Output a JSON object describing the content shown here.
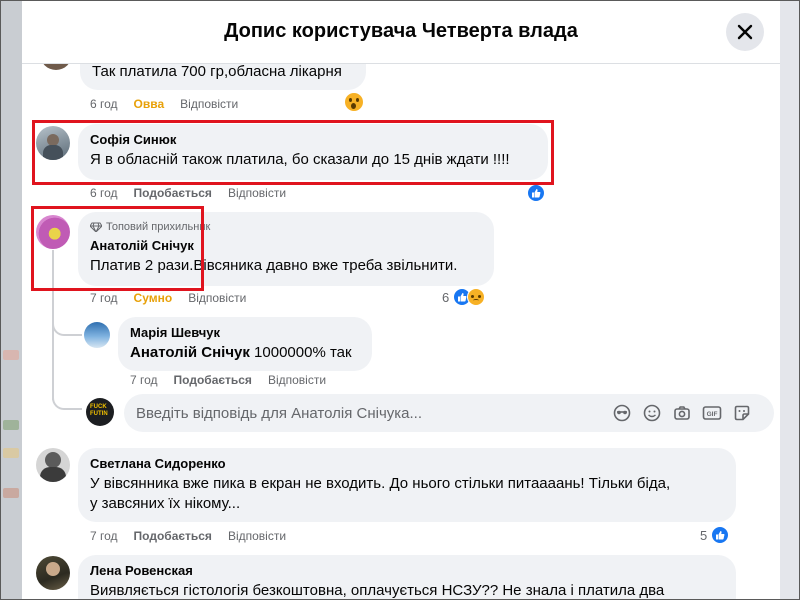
{
  "dialog": {
    "title": "Допис користувача Четверта влада"
  },
  "comments": [
    {
      "id": "top",
      "text": "Так платила 700 гр,обласна лікарня",
      "time": "6 год",
      "reaction_label": "Овва",
      "reply_label": "Відповісти"
    },
    {
      "id": "sofia",
      "author": "Софія Синюк",
      "text": "Я в обласній також платила, бо сказали до 15 днів ждати !!!!",
      "time": "6 год",
      "like_label": "Подобається",
      "reply_label": "Відповісти"
    },
    {
      "id": "anatolii",
      "badge": "Топовий прихильник",
      "author": "Анатолій Снічук",
      "text": "Платив 2 рази.Вівсяника давно вже треба звільнити.",
      "time": "7 год",
      "reaction_label": "Сумно",
      "reply_label": "Відповісти",
      "reaction_count": "6"
    },
    {
      "id": "mariia",
      "author": "Марія Шевчук",
      "mention": "Анатолій Снічук",
      "text": " 1000000% так",
      "time": "7 год",
      "like_label": "Подобається",
      "reply_label": "Відповісти"
    },
    {
      "id": "svetlana",
      "author": "Светлана Сидоренко",
      "text_lines": [
        "У вівсянника вже пика в екран не входить. До нього стільки питаааань! Тільки біда,",
        "у завсяних їх нікому..."
      ],
      "time": "7 год",
      "like_label": "Подобається",
      "reply_label": "Відповісти",
      "reaction_count": "5"
    },
    {
      "id": "lena",
      "author": "Лена Ровенская",
      "text": "Виявляється гістологія безкоштовна, оплачується НСЗУ?? Не знала і платила два"
    }
  ],
  "reply_box": {
    "placeholder": "Введіть відповідь для Анатолія Снічука..."
  },
  "icons": {
    "close": "close-icon",
    "diamond": "diamond-icon",
    "like": "like-icon",
    "sad": "sad-emoji-icon",
    "wow": "wow-emoji-icon",
    "avatar_sticker": "avatar-sticker-icon",
    "emoji": "emoji-icon",
    "camera": "camera-icon",
    "gif": "gif-icon",
    "sticker": "sticker-icon"
  },
  "colors": {
    "accent": "#1877f2",
    "highlight_box": "#e0141e",
    "bubble": "#f0f2f5"
  }
}
